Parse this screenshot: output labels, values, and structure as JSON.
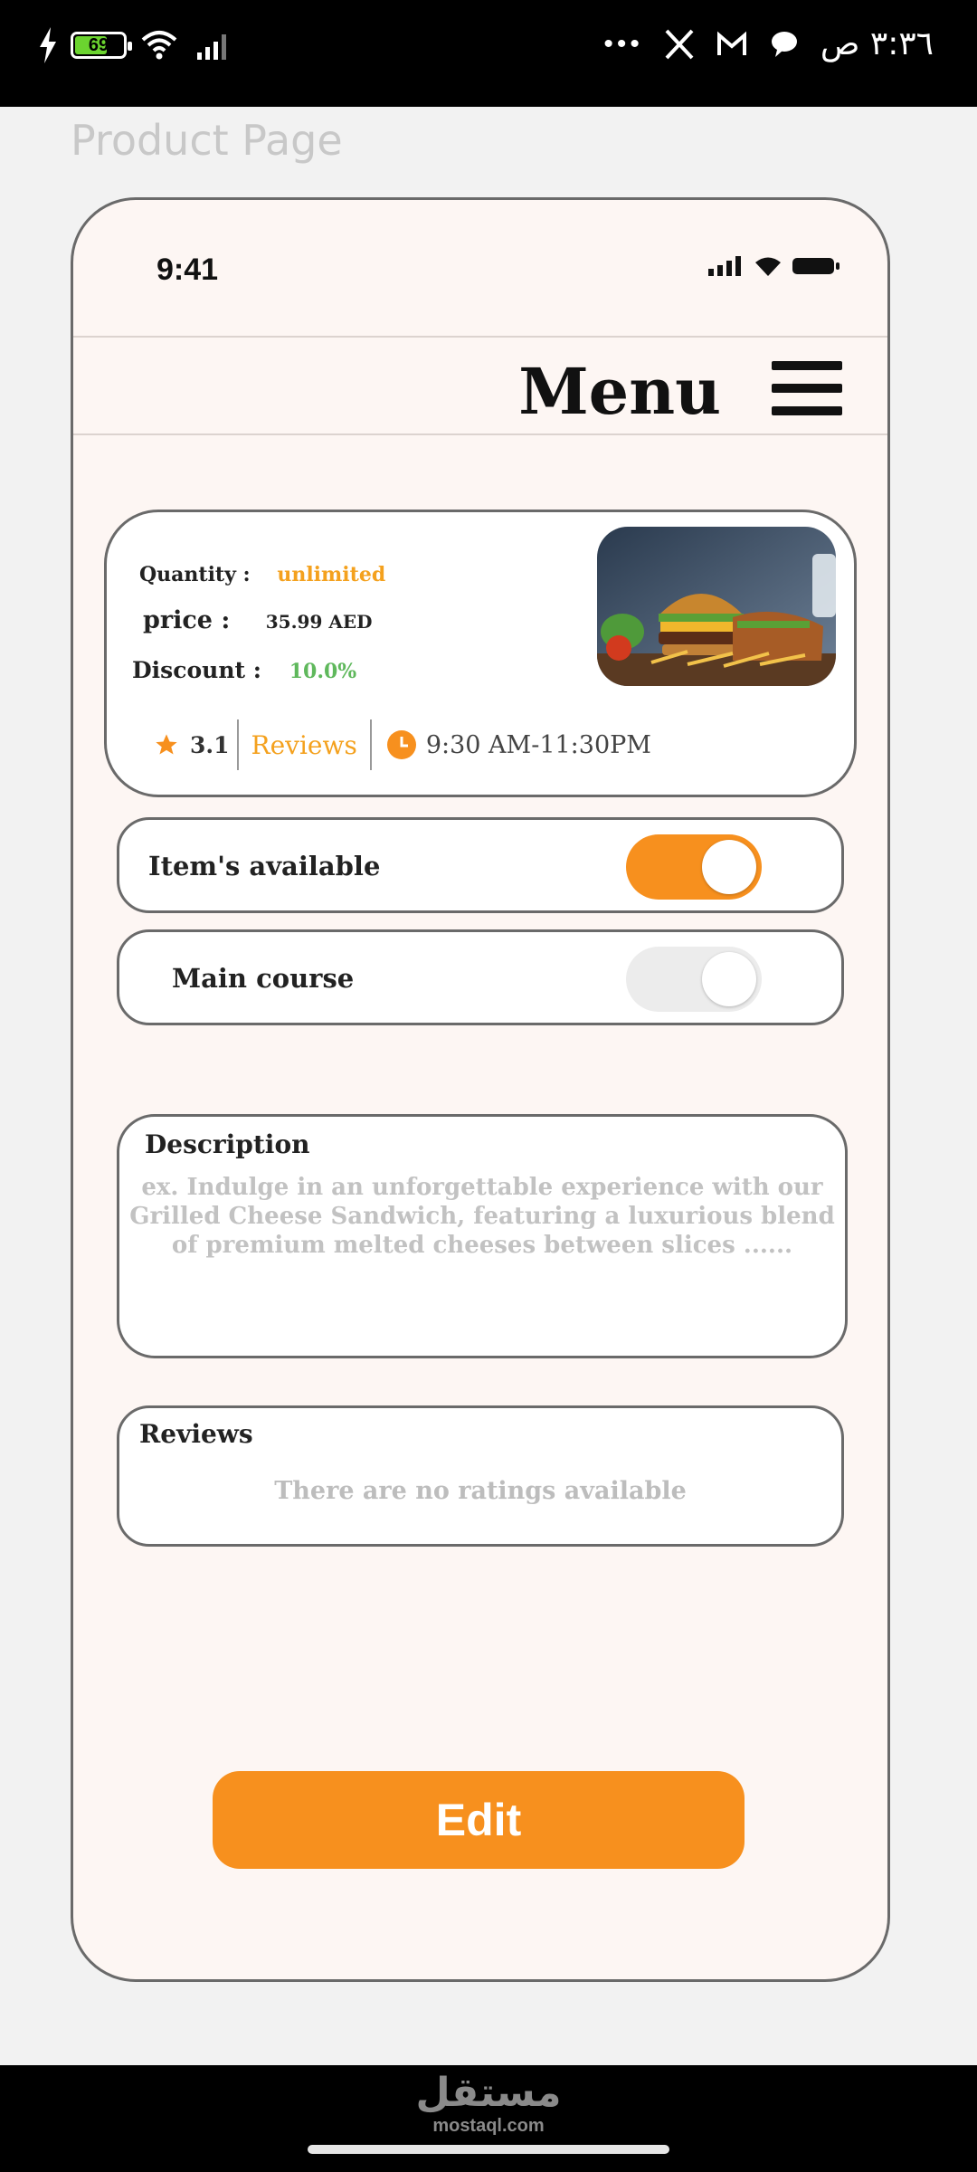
{
  "system_status": {
    "battery": "69",
    "battery_level": 0.69,
    "time": "٣:٣٦ ص",
    "overflow": "•••"
  },
  "page_label": "Product Page",
  "device": {
    "time": "9:41"
  },
  "header": {
    "title": "Menu"
  },
  "product": {
    "quantity_label": "Quantity :",
    "quantity_value": "unlimited",
    "price_label": "price :",
    "price_value": "35.99 AED",
    "discount_label": "Discount :",
    "discount_value": "10.0%",
    "rating": "3.1",
    "reviews_link": "Reviews",
    "hours": "9:30 AM-11:30PM"
  },
  "toggles": [
    {
      "label": "Item's available",
      "on": true
    },
    {
      "label": "Main course",
      "on": false
    }
  ],
  "description": {
    "title": "Description",
    "placeholder": "ex. Indulge in an unforgettable experience with our Grilled Cheese Sandwich, featuring a luxurious blend of premium melted cheeses between slices ......"
  },
  "reviews": {
    "title": "Reviews",
    "empty_text": "There are no ratings available"
  },
  "edit_button": "Edit",
  "watermark": {
    "arabic": "مستقل",
    "latin": "mostaql.com"
  },
  "colors": {
    "accent": "#f7901e",
    "discount": "#5fb85c",
    "frame": "#fdf6f3"
  }
}
